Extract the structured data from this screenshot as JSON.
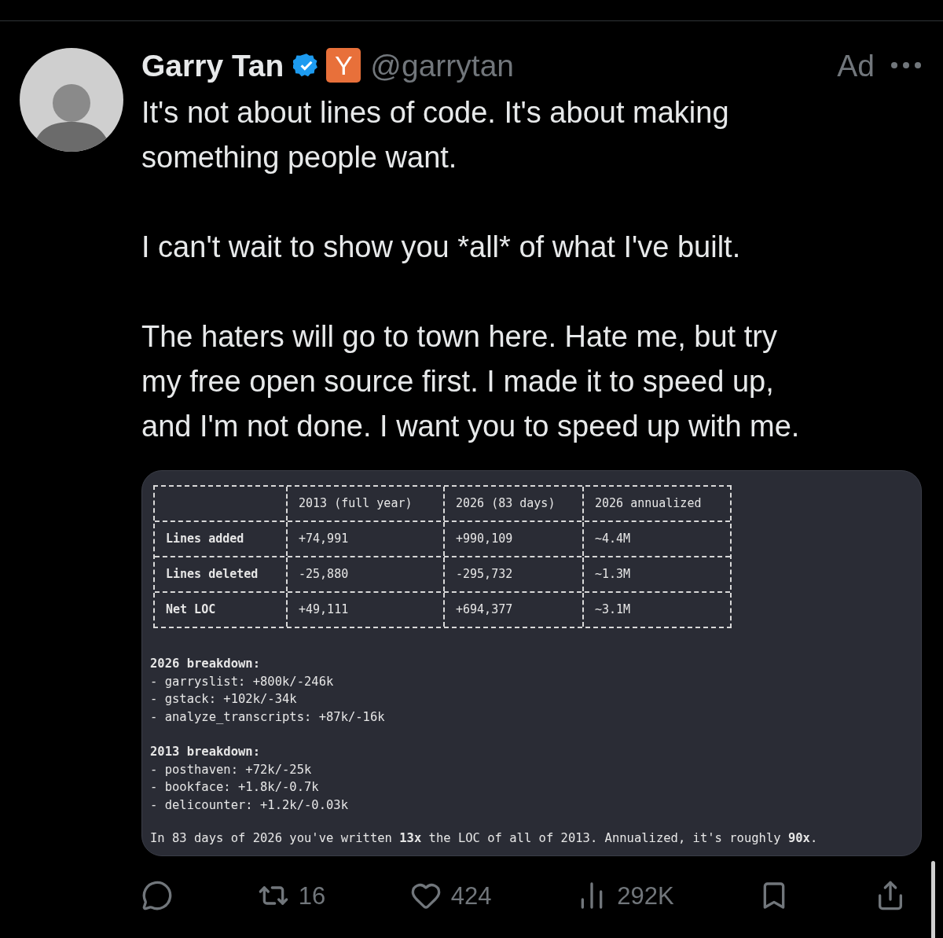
{
  "author": {
    "name": "Garry Tan",
    "verified": true,
    "badge": "Y",
    "handle": "@garrytan"
  },
  "ad_label": "Ad",
  "paragraphs": [
    [
      "It's not about lines of code. It's about making",
      "something people want."
    ],
    [
      "I can't wait to show you *all* of what I've built."
    ],
    [
      "The haters will go to town here. Hate me, but try",
      "my free open source first. I made it to speed up,",
      "and I'm not done. I want you to speed up with me."
    ]
  ],
  "image": {
    "table": {
      "columns": [
        "",
        "2013 (full year)",
        "2026 (83 days)",
        "2026 annualized"
      ],
      "rows": [
        [
          "Lines added",
          "+74,991",
          "+990,109",
          "~4.4M"
        ],
        [
          "Lines deleted",
          "-25,880",
          "-295,732",
          "~1.3M"
        ],
        [
          "Net LOC",
          "+49,111",
          "+694,377",
          "~3.1M"
        ]
      ]
    },
    "sections": [
      {
        "heading": "2026 breakdown:",
        "items": [
          "- garryslist: +800k/-246k",
          "- gstack: +102k/-34k",
          "- analyze_transcripts: +87k/-16k"
        ]
      },
      {
        "heading": "2013 breakdown:",
        "items": [
          "- posthaven: +72k/-25k",
          "- bookface: +1.8k/-0.7k",
          "- delicounter: +1.2k/-0.03k"
        ]
      }
    ],
    "summary": "In 83 days of 2026 you've written **13x** the LOC of all of 2013. Annualized, it's roughly **90x**."
  },
  "actions": [
    {
      "kind": "reply"
    },
    {
      "kind": "repost",
      "count": "16"
    },
    {
      "kind": "like",
      "count": "424"
    },
    {
      "kind": "views",
      "count": "292K"
    },
    {
      "kind": "bookmark"
    },
    {
      "kind": "share"
    }
  ]
}
